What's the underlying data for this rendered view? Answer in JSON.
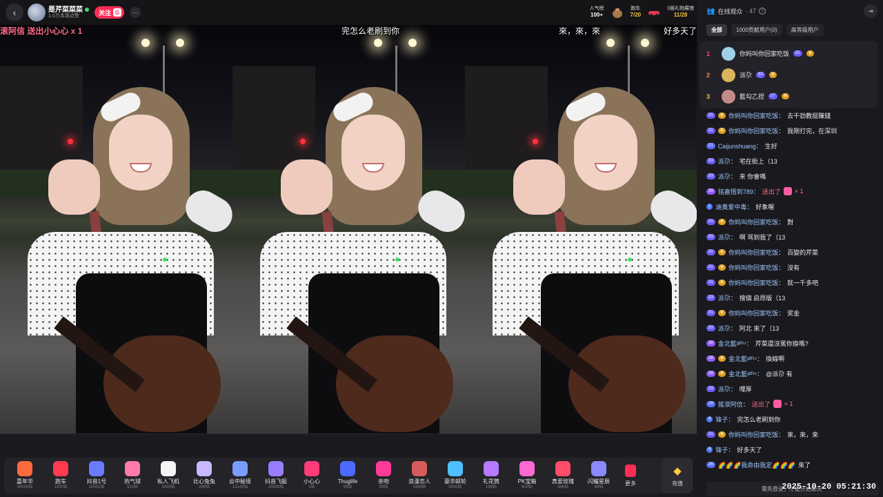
{
  "header": {
    "streamer_name": "是芹菜菜菜",
    "streamer_sub": "1.0万本场点赞",
    "follow_label": "关注",
    "fan_badge": "G",
    "more": "···",
    "back_icon": "chevron-left-icon"
  },
  "top_stats": {
    "popularity": {
      "label": "人气榜",
      "value": "100+"
    },
    "race": {
      "label": "跑车",
      "value": "7/20"
    },
    "event": {
      "label": "3届礼物展馆",
      "value": "11/28"
    }
  },
  "danmu": {
    "gift_line": "滚阿信 送出小心心 x 1",
    "line1": "完怎么老刷到你",
    "line2": "來，來，來",
    "line3": "好多天了"
  },
  "gifts": [
    {
      "name": "嘉年华",
      "price": "30000钻",
      "color": "#ff6a3d",
      "icon": "carnival-icon"
    },
    {
      "name": "跑车",
      "price": "1200钻",
      "color": "#ff3b52",
      "icon": "sports-car-icon"
    },
    {
      "name": "抖音1号",
      "price": "10001钻",
      "color": "#6a7bff",
      "icon": "rocket-icon"
    },
    {
      "name": "热气球",
      "price": "520钻",
      "color": "#ff7aa8",
      "icon": "hot-air-balloon-icon"
    },
    {
      "name": "私人飞机",
      "price": "3000钻",
      "color": "#f5f5f5",
      "icon": "private-jet-icon"
    },
    {
      "name": "比心兔兔",
      "price": "299钻",
      "color": "#c9b7ff",
      "icon": "heart-bunny-icon"
    },
    {
      "name": "云中秘境",
      "price": "13140钻",
      "color": "#7a9bff",
      "icon": "cloud-realm-icon"
    },
    {
      "name": "抖音飞艇",
      "price": "20000钻",
      "color": "#9a7dff",
      "icon": "airship-icon"
    },
    {
      "name": "小心心",
      "price": "1钻",
      "color": "#ff3b7a",
      "icon": "heart-icon"
    },
    {
      "name": "Thuglife",
      "price": "99钻",
      "color": "#4d6bff",
      "icon": "sunglasses-icon"
    },
    {
      "name": "亲吻",
      "price": "99钻",
      "color": "#ff3b9a",
      "icon": "kiss-icon"
    },
    {
      "name": "浪漫恋人",
      "price": "1999钻",
      "color": "#d65b5b",
      "icon": "lovers-icon"
    },
    {
      "name": "豪华邮轮",
      "price": "6000钻",
      "color": "#4fc0ff",
      "icon": "cruise-ship-icon"
    },
    {
      "name": "礼花筒",
      "price": "199钻",
      "color": "#b57aff",
      "icon": "confetti-icon"
    },
    {
      "name": "PK宝箱",
      "price": "600钻",
      "color": "#ff6ad0",
      "icon": "treasure-chest-icon"
    },
    {
      "name": "真爱玫瑰",
      "price": "366钻",
      "color": "#ff4d6a",
      "icon": "rose-icon"
    },
    {
      "name": "闪耀星辰",
      "price": "99钻",
      "color": "#8a8aff",
      "icon": "star-icon"
    }
  ],
  "gift_more_label": "更多",
  "recharge_label": "充值",
  "sidebar": {
    "title": "在线观众",
    "viewer_count": "· 47",
    "tabs": [
      "全部",
      "1000贡献用户(0)",
      "高等级用户"
    ],
    "rank": [
      {
        "rank": "1",
        "name": "你妈叫你回家吃饭",
        "level": "31",
        "avatar_color": "#9fd0e8"
      },
      {
        "rank": "2",
        "name": "派尕",
        "level": "33",
        "avatar_color": "#d8b45a"
      },
      {
        "rank": "3",
        "name": "藍勾乙捏",
        "level": "27",
        "avatar_color": "#c48a8a"
      }
    ]
  },
  "chat": [
    {
      "level": "31",
      "lvl_color": "#6a5cff",
      "fan": true,
      "user": "你妈叫你回家吃饭：",
      "text": "去干劲教挺賺錢"
    },
    {
      "level": "31",
      "lvl_color": "#6a5cff",
      "fan": true,
      "user": "你妈叫你回家吃饭：",
      "text": "我剛打完，在深圳"
    },
    {
      "level": "21",
      "lvl_color": "#5a6cff",
      "fan": false,
      "user": "Caijunshuang：",
      "text": "生好"
    },
    {
      "level": "33",
      "lvl_color": "#6a5cff",
      "fan": false,
      "user": "派尕：",
      "text": "宅在街上（13"
    },
    {
      "level": "33",
      "lvl_color": "#6a5cff",
      "fan": false,
      "user": "派尕：",
      "text": "来 你會嗎"
    },
    {
      "level": "39",
      "lvl_color": "#8a5cff",
      "fan": false,
      "user": "铭嘉悟到789：",
      "gift": "送出了",
      "text": "× 1"
    },
    {
      "level": "1",
      "lvl_color": "#4a7cff",
      "fan": false,
      "user": "迪奥爱中毒：",
      "text": "好象喔"
    },
    {
      "level": "31",
      "lvl_color": "#6a5cff",
      "fan": true,
      "user": "你妈叫你回家吃饭：",
      "text": "對"
    },
    {
      "level": "33",
      "lvl_color": "#6a5cff",
      "fan": false,
      "user": "派尕：",
      "text": "啊 骂到我了（13"
    },
    {
      "level": "31",
      "lvl_color": "#6a5cff",
      "fan": true,
      "user": "你妈叫你回家吃饭：",
      "text": "百變的芹菜"
    },
    {
      "level": "31",
      "lvl_color": "#6a5cff",
      "fan": true,
      "user": "你妈叫你回家吃饭：",
      "text": "沒有"
    },
    {
      "level": "31",
      "lvl_color": "#6a5cff",
      "fan": true,
      "user": "你妈叫你回家吃饭：",
      "text": "就一千多吧"
    },
    {
      "level": "33",
      "lvl_color": "#6a5cff",
      "fan": false,
      "user": "派尕：",
      "text": "搜個 启昂版（13"
    },
    {
      "level": "31",
      "lvl_color": "#6a5cff",
      "fan": true,
      "user": "你妈叫你回家吃饭：",
      "text": "奖金"
    },
    {
      "level": "33",
      "lvl_color": "#6a5cff",
      "fan": false,
      "user": "派尕：",
      "text": "阿北 來了（13"
    },
    {
      "level": "38",
      "lvl_color": "#8a5cff",
      "fan": false,
      "user": "金北藍ᵍᴮ³⁴：",
      "text": "芹菜還沒罵你換嗎?"
    },
    {
      "level": "38",
      "lvl_color": "#8a5cff",
      "fan": true,
      "user": "金北藍ᵍᴮ³⁴：",
      "text": "換線啊"
    },
    {
      "level": "38",
      "lvl_color": "#8a5cff",
      "fan": true,
      "user": "金北藍ᵍᴮ³⁴：",
      "text": "@派尕 有"
    },
    {
      "level": "33",
      "lvl_color": "#6a5cff",
      "fan": false,
      "user": "派尕：",
      "text": "哩厚"
    },
    {
      "level": "29",
      "lvl_color": "#5a6cff",
      "fan": false,
      "user": "搖滾阿信：",
      "gift": "送出了",
      "text": "× 1"
    },
    {
      "level": "4",
      "lvl_color": "#4a7cff",
      "fan": false,
      "user": "锋子：",
      "text": "完怎么老刷到你"
    },
    {
      "level": "31",
      "lvl_color": "#6a5cff",
      "fan": true,
      "user": "你妈叫你回家吃饭：",
      "text": "來，來，來"
    },
    {
      "level": "4",
      "lvl_color": "#4a7cff",
      "fan": false,
      "user": "锋子：",
      "text": "好多天了"
    },
    {
      "level": "26",
      "lvl_color": "#5a6cff",
      "fan": false,
      "user": "🌈🌈🌈我命由我定🌈🌈🌈",
      "text": "來了"
    }
  ],
  "chat_input": "需先登录，才能开始聊天",
  "timestamp": "2025-10-20 05:21:30"
}
